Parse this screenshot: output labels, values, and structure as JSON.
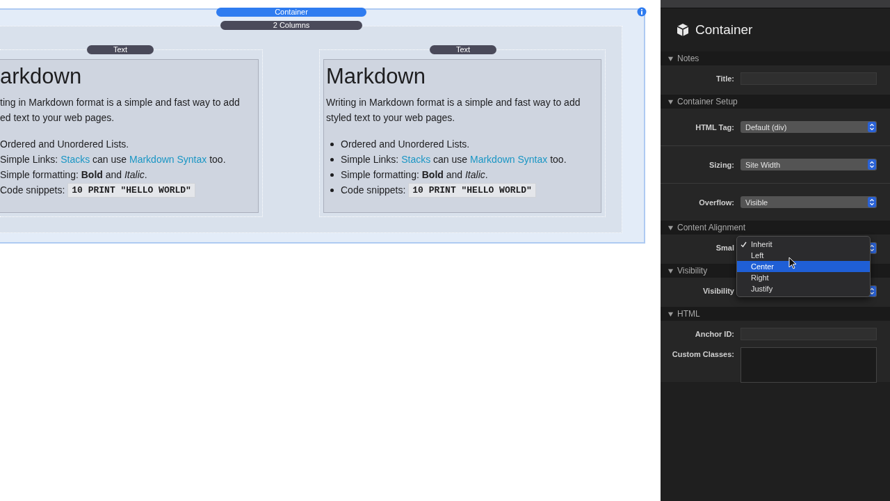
{
  "canvas": {
    "container_label": "Container",
    "columns_label": "2 Columns",
    "columns": [
      {
        "badge": "Text",
        "heading": "arkdown",
        "bullets": false,
        "paragraph": [
          "ting in Markdown format is a simple and fast way to add",
          "ed text to your web pages."
        ],
        "list": [
          [
            {
              "kind": "text",
              "text": "Ordered and Unordered Lists."
            }
          ],
          [
            {
              "kind": "text",
              "text": "Simple Links: "
            },
            {
              "kind": "link",
              "text": "Stacks"
            },
            {
              "kind": "text",
              "text": " can use "
            },
            {
              "kind": "link",
              "text": "Markdown Syntax"
            },
            {
              "kind": "text",
              "text": " too."
            }
          ],
          [
            {
              "kind": "text",
              "text": "Simple formatting: **Bold** and *Italic*."
            }
          ],
          [
            {
              "kind": "text",
              "text": "Code snippets: "
            },
            {
              "kind": "code",
              "text": "10 PRINT \"HELLO WORLD\""
            }
          ]
        ]
      },
      {
        "badge": "Text",
        "heading": "Markdown",
        "bullets": true,
        "paragraph": [
          "Writing in Markdown format is a simple and fast way to add",
          "styled text to your web pages."
        ],
        "list": [
          [
            {
              "kind": "text",
              "text": "Ordered and Unordered Lists."
            }
          ],
          [
            {
              "kind": "text",
              "text": "Simple Links: "
            },
            {
              "kind": "link",
              "text": "Stacks"
            },
            {
              "kind": "text",
              "text": " can use "
            },
            {
              "kind": "link",
              "text": "Markdown Syntax"
            },
            {
              "kind": "text",
              "text": " too."
            }
          ],
          [
            {
              "kind": "text",
              "text": "Simple formatting: **Bold** and *Italic*."
            }
          ],
          [
            {
              "kind": "text",
              "text": "Code snippets: "
            },
            {
              "kind": "code",
              "text": "10 PRINT \"HELLO WORLD\""
            }
          ]
        ]
      }
    ]
  },
  "inspector": {
    "title": "Container",
    "sections": [
      {
        "title": "Notes",
        "expanded": true,
        "rows": [
          {
            "kind": "text",
            "label": "Title:"
          }
        ]
      },
      {
        "title": "Container Setup",
        "expanded": true,
        "dividers": true,
        "rows": [
          {
            "kind": "select",
            "label": "HTML Tag:",
            "value": "Default (div)"
          },
          {
            "kind": "select",
            "label": "Sizing:",
            "value": "Site Width"
          },
          {
            "kind": "select",
            "label": "Overflow:",
            "value": "Visible"
          }
        ]
      },
      {
        "title": "Content Alignment",
        "expanded": true,
        "rows": [
          {
            "kind": "select",
            "label": "Smal",
            "menu": [
              {
                "label": "Inherit",
                "checked": true,
                "selected": false
              },
              {
                "label": "Left",
                "checked": false,
                "selected": false
              },
              {
                "label": "Center",
                "checked": false,
                "selected": true
              },
              {
                "label": "Right",
                "checked": false,
                "selected": false
              },
              {
                "label": "Justify",
                "checked": false,
                "selected": false
              }
            ]
          }
        ]
      },
      {
        "title": "Visibility",
        "expanded": true,
        "rows": [
          {
            "kind": "select",
            "label": "Visibility"
          }
        ]
      },
      {
        "title": "HTML",
        "expanded": true,
        "rows": [
          {
            "kind": "text",
            "label": "Anchor ID:"
          },
          {
            "kind": "textarea",
            "label": "Custom Classes:"
          }
        ]
      }
    ]
  }
}
